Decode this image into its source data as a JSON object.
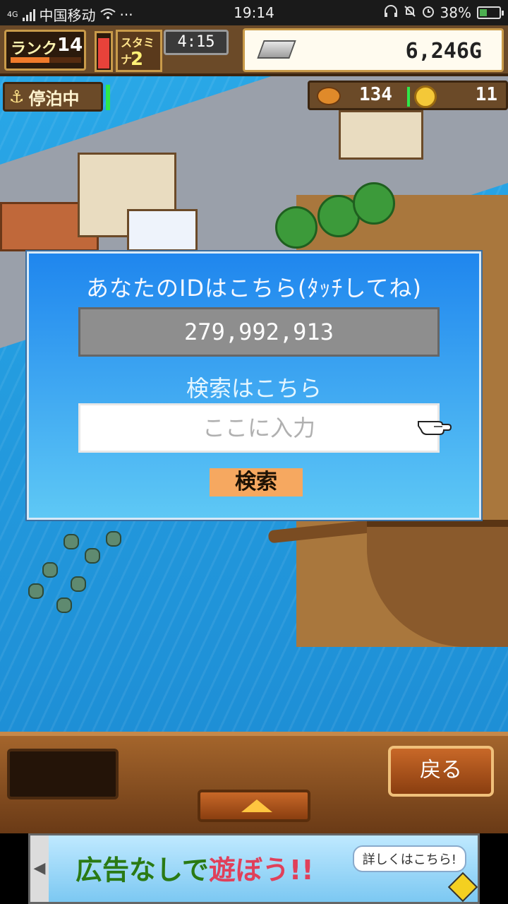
{
  "status_bar": {
    "network": "4G",
    "carrier": "中国移动",
    "more": "···",
    "time": "19:14",
    "battery": "38%",
    "battery_level": 0.38
  },
  "hud": {
    "rank_label": "ランク",
    "rank_value": "14",
    "rank_progress": 0.55,
    "stamina_gauge_level": 0.9,
    "stamina_label": "スタミナ",
    "stamina_value": "2",
    "timer": "4:15",
    "gold": "6,246G",
    "moor_status": "停泊中",
    "resource1": "134",
    "resource2": "11"
  },
  "dialog": {
    "title": "あなたのIDはこちら(ﾀｯﾁしてね)",
    "id_value": "279,992,913",
    "search_label": "検索はこちら",
    "search_placeholder": "ここに入力",
    "search_button": "検索"
  },
  "bottom": {
    "back_button": "戻る"
  },
  "ad": {
    "text_part1": "広告なしで",
    "text_part2": "遊ぼう!!",
    "detail_button": "詳しくはこちら!"
  }
}
